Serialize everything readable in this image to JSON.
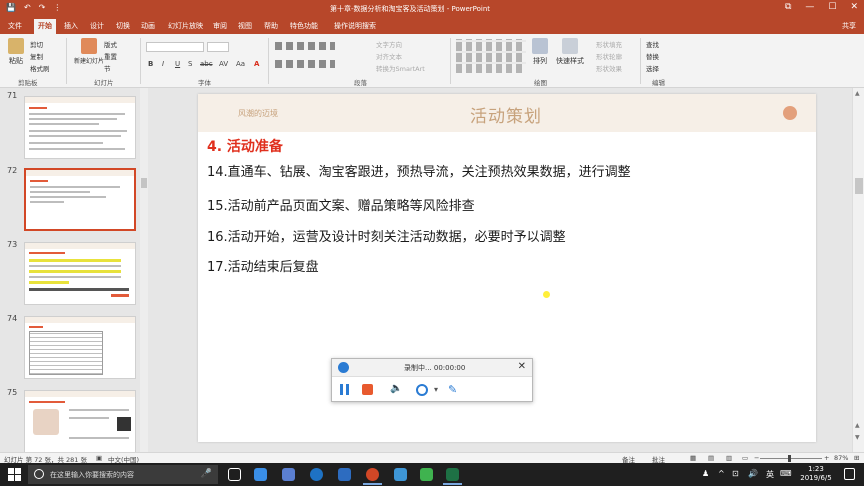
{
  "window": {
    "title": "第十章-数据分析和淘宝客及活动策划 - PowerPoint",
    "qat": {
      "save": "💾",
      "undo": "↶",
      "redo": "↷",
      "more": "⋮"
    },
    "controls": {
      "ribbon_opts": "⧉",
      "minimize": "—",
      "maximize": "☐",
      "close": "✕"
    }
  },
  "ribbon_tabs": [
    "文件",
    "开始",
    "插入",
    "设计",
    "切换",
    "动画",
    "幻灯片放映",
    "审阅",
    "视图",
    "帮助",
    "特色功能",
    "操作说明搜索"
  ],
  "ribbon_active_tab": "开始",
  "share_label": "共享",
  "ribbon": {
    "clipboard": {
      "paste": "粘贴",
      "cut": "剪切",
      "copy": "复制",
      "format_painter": "格式刷",
      "group": "剪贴板"
    },
    "slides": {
      "new_slide": "新建幻灯片",
      "layout": "版式",
      "reset": "重置",
      "section": "节",
      "group": "幻灯片"
    },
    "font": {
      "bold": "B",
      "italic": "I",
      "underline": "U",
      "shadow": "S",
      "strike": "abc",
      "spacing": "AV",
      "case": "Aa",
      "color": "A",
      "group": "字体"
    },
    "paragraph": {
      "text_direction": "文字方向",
      "align_text": "对齐文本",
      "smartart": "转换为SmartArt",
      "group": "段落"
    },
    "drawing": {
      "arrange": "排列",
      "quick_styles": "快速样式",
      "shape_fill": "形状填充",
      "shape_outline": "形状轮廓",
      "shape_effects": "形状效果",
      "group": "绘图"
    },
    "editing": {
      "find": "查找",
      "replace": "替换",
      "select": "选择",
      "group": "编辑"
    }
  },
  "thumbnails": [
    {
      "num": "71",
      "selected": false
    },
    {
      "num": "72",
      "selected": true
    },
    {
      "num": "73",
      "selected": false
    },
    {
      "num": "74",
      "selected": false
    },
    {
      "num": "75",
      "selected": false
    }
  ],
  "slide": {
    "header_left": "风潮的迈境",
    "title": "活动策划",
    "heading": "4. 活动准备",
    "items": [
      "14.直通车、钻展、淘宝客跟进，预热导流，关注预热效果数据，进行调整",
      "15.活动前产品页面文案、赠品策略等风险排查",
      "16.活动开始，运营及设计时刻关注活动数据，必要时予以调整",
      "17.活动结束后复盘"
    ]
  },
  "recorder": {
    "status": "录制中... 00:00:00",
    "close": "✕",
    "volume": "🔈",
    "dropdown": "▾",
    "pen": "✎"
  },
  "statusbar": {
    "slide_info": "幻灯片 第 72 张，共 281 张",
    "language": "中文(中国)",
    "notes": "备注",
    "comments": "批注",
    "zoom_minus": "−",
    "zoom_plus": "+",
    "zoom": "87%"
  },
  "taskbar": {
    "search_placeholder": "在这里输入你要搜索的内容",
    "mic": "🎤",
    "time": "1:23",
    "date": "2019/6/5",
    "tray_up": "^",
    "tray_net": "⊡",
    "tray_vol": "🔊",
    "ime": "英"
  },
  "colors": {
    "accent": "#b7472a",
    "heading_red": "#e0301e",
    "header_bg": "#f6efe7",
    "header_gold": "#c7a27c"
  }
}
